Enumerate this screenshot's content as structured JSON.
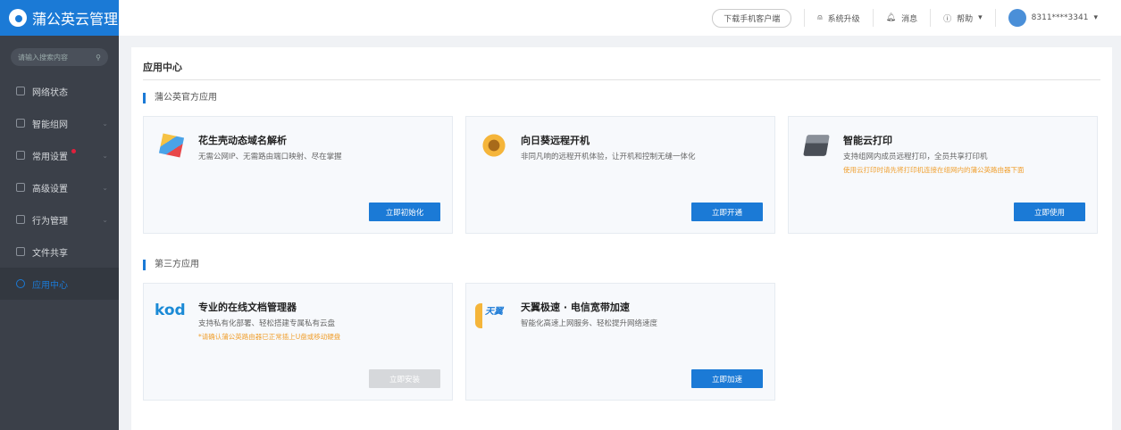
{
  "app": {
    "title": "蒲公英云管理"
  },
  "sidebar": {
    "search_placeholder": "请输入搜索内容",
    "items": [
      {
        "label": "网络状态"
      },
      {
        "label": "智能组网"
      },
      {
        "label": "常用设置"
      },
      {
        "label": "高级设置"
      },
      {
        "label": "行为管理"
      },
      {
        "label": "文件共享"
      },
      {
        "label": "应用中心"
      }
    ]
  },
  "topbar": {
    "download": "下载手机客户端",
    "upgrade": "系统升级",
    "messages": "消息",
    "help": "帮助",
    "user": "8311****3341"
  },
  "main": {
    "title": "应用中心",
    "official": {
      "heading": "蒲公英官方应用",
      "apps": [
        {
          "title": "花生壳动态域名解析",
          "desc": "无需公网IP、无需路由端口映射、尽在掌握",
          "note": "",
          "button": "立即初始化"
        },
        {
          "title": "向日葵远程开机",
          "desc": "非同凡响的远程开机体验，让开机和控制无缝一体化",
          "note": "",
          "button": "立即开通"
        },
        {
          "title": "智能云打印",
          "desc": "支持组网内成员远程打印，全员共享打印机",
          "note": "使用云打印时请先将打印机连接在组网内的蒲公英路由器下面",
          "button": "立即使用"
        }
      ]
    },
    "third": {
      "heading": "第三方应用",
      "apps": [
        {
          "title": "专业的在线文档管理器",
          "desc": "支持私有化部署、轻松搭建专属私有云盘",
          "note": "*请确认蒲公英路由器已正常插上U盘或移动硬盘",
          "button": "立即安装",
          "logo": "kod"
        },
        {
          "title": "天翼极速 · 电信宽带加速",
          "desc": "智能化高速上网服务、轻松提升网络速度",
          "note": "",
          "button": "立即加速",
          "logo": "天翼"
        }
      ]
    }
  }
}
